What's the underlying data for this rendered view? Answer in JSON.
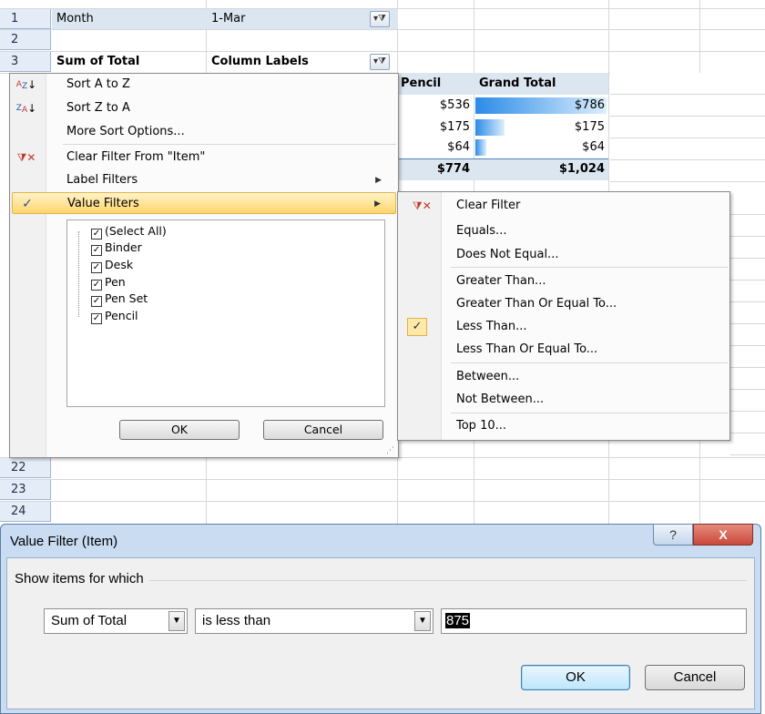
{
  "sheet": {
    "rows": [
      "1",
      "2",
      "3",
      "22",
      "23",
      "24"
    ],
    "r1": {
      "a": "Month",
      "b": "1-Mar"
    },
    "r3": {
      "a": "Sum of Total",
      "b": "Column Labels"
    },
    "headers": {
      "pencil": "Pencil",
      "grand_total": "Grand Total"
    },
    "data_rows": [
      {
        "pencil": "$536",
        "grand_total": "$786"
      },
      {
        "pencil": "$175",
        "grand_total": "$175"
      },
      {
        "pencil": "$64",
        "grand_total": "$64"
      }
    ],
    "total_row": {
      "pencil": "$774",
      "grand_total": "$1,024"
    },
    "colors": {
      "databar": "#2b8be8",
      "row_header": "#e4ecf7",
      "total_fill": "#dce6f1"
    }
  },
  "filter_menu": {
    "items": [
      {
        "label": "Sort A to Z",
        "icon": "sort-az-icon"
      },
      {
        "label": "Sort Z to A",
        "icon": "sort-za-icon"
      },
      {
        "label": "More Sort Options..."
      },
      {
        "label": "Clear Filter From \"Item\"",
        "icon": "clear-filter-icon"
      },
      {
        "label": "Label Filters"
      },
      {
        "label": "Value Filters"
      }
    ],
    "checkbox_list": [
      "(Select All)",
      "Binder",
      "Desk",
      "Pen",
      "Pen Set",
      "Pencil"
    ],
    "ok_label": "OK",
    "cancel_label": "Cancel"
  },
  "submenu": {
    "items": [
      {
        "label": "Clear Filter"
      },
      {
        "label": "Equals..."
      },
      {
        "label": "Does Not Equal..."
      },
      {
        "label": "Greater Than..."
      },
      {
        "label": "Greater Than Or Equal To..."
      },
      {
        "label": "Less Than..."
      },
      {
        "label": "Less Than Or Equal To..."
      },
      {
        "label": "Between..."
      },
      {
        "label": "Not Between..."
      },
      {
        "label": "Top 10..."
      }
    ]
  },
  "dialog": {
    "title": "Value Filter (Item)",
    "section_label": "Show items for which",
    "field_select": "Sum of Total",
    "operator_select": "is less than",
    "value_input": "875",
    "ok_label": "OK",
    "cancel_label": "Cancel",
    "help_label": "?",
    "close_label": "X",
    "close_color": "#c9483a"
  }
}
